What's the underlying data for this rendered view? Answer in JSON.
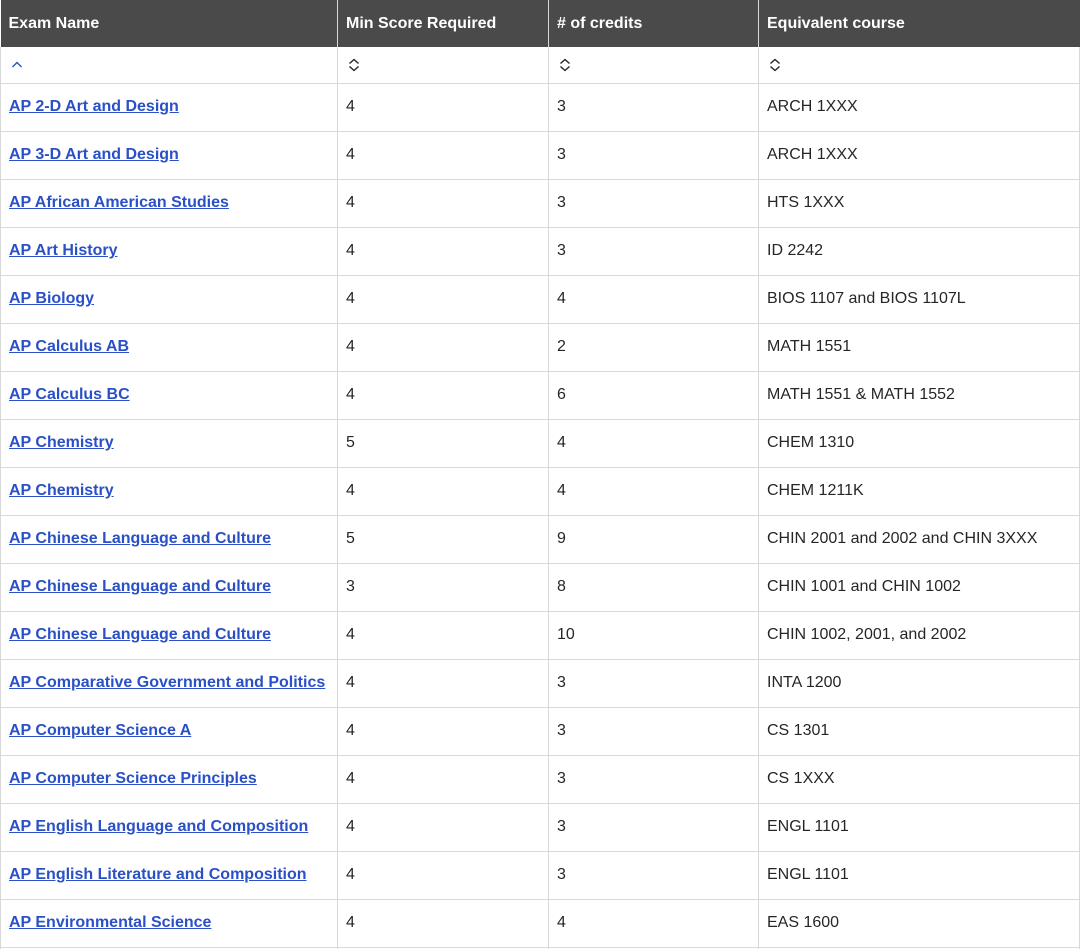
{
  "table": {
    "headers": [
      "Exam Name",
      "Min Score Required",
      "# of credits",
      "Equivalent course"
    ],
    "sort_icons": [
      "chevron-up-icon",
      "sort-updown-icon",
      "sort-updown-icon",
      "sort-updown-icon"
    ],
    "rows": [
      {
        "exam": "AP 2-D Art and Design",
        "score": "4",
        "credits": "3",
        "course": "ARCH 1XXX"
      },
      {
        "exam": "AP 3-D Art and Design",
        "score": "4",
        "credits": "3",
        "course": "ARCH 1XXX"
      },
      {
        "exam": "AP African American Studies",
        "score": "4",
        "credits": "3",
        "course": "HTS 1XXX"
      },
      {
        "exam": "AP Art History",
        "score": "4",
        "credits": "3",
        "course": "ID 2242"
      },
      {
        "exam": "AP Biology",
        "score": "4",
        "credits": "4",
        "course": "BIOS 1107 and BIOS 1107L"
      },
      {
        "exam": "AP Calculus AB",
        "score": "4",
        "credits": "2",
        "course": "MATH 1551"
      },
      {
        "exam": "AP Calculus BC",
        "score": "4",
        "credits": "6",
        "course": "MATH 1551 & MATH 1552"
      },
      {
        "exam": "AP Chemistry",
        "score": "5",
        "credits": "4",
        "course": "CHEM 1310"
      },
      {
        "exam": "AP Chemistry",
        "score": "4",
        "credits": "4",
        "course": "CHEM 1211K"
      },
      {
        "exam": "AP Chinese Language and Culture",
        "score": "5",
        "credits": "9",
        "course": "CHIN 2001 and 2002 and CHIN 3XXX"
      },
      {
        "exam": "AP Chinese Language and Culture",
        "score": "3",
        "credits": "8",
        "course": "CHIN 1001 and CHIN 1002"
      },
      {
        "exam": "AP Chinese Language and Culture",
        "score": "4",
        "credits": "10",
        "course": "CHIN 1002, 2001, and 2002"
      },
      {
        "exam": "AP Comparative Government and Politics",
        "score": "4",
        "credits": "3",
        "course": "INTA 1200"
      },
      {
        "exam": "AP Computer Science A",
        "score": "4",
        "credits": "3",
        "course": "CS 1301"
      },
      {
        "exam": "AP Computer Science Principles",
        "score": "4",
        "credits": "3",
        "course": "CS 1XXX"
      },
      {
        "exam": "AP English Language and Composition",
        "score": "4",
        "credits": "3",
        "course": "ENGL 1101"
      },
      {
        "exam": "AP English Literature and Composition",
        "score": "4",
        "credits": "3",
        "course": "ENGL 1101"
      },
      {
        "exam": "AP Environmental Science",
        "score": "4",
        "credits": "4",
        "course": "EAS 1600"
      },
      {
        "exam": "",
        "score": "",
        "credits": "",
        "course": ""
      }
    ]
  },
  "colors": {
    "header_bg": "#4a4a4a",
    "header_text": "#ffffff",
    "link": "#2a50c8",
    "border": "#d8d8d8",
    "active_sort": "#2a50c8"
  }
}
